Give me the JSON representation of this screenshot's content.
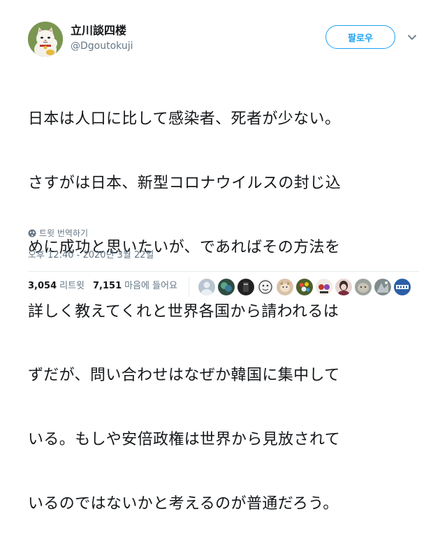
{
  "user": {
    "display_name": "立川談四楼",
    "handle": "@Dgoutokuji"
  },
  "follow_button": {
    "label": "팔로우"
  },
  "tweet": {
    "text_lines": [
      "日本は人口に比して感染者、死者が少ない。",
      "さすがは日本、新型コロナウイルスの封じ込",
      "めに成功と思いたいが、であればその方法を",
      "詳しく教えてくれと世界各国から請われるは",
      "ずだが、問い合わせはなぜか韓国に集中して",
      "いる。もしや安倍政権は世界から見放されて",
      "いるのではないかと考えるのが普通だろう。"
    ]
  },
  "translate": {
    "label": "트윗 번역하기"
  },
  "timestamp": "오후 12:40 - 2020년 3월 22일",
  "stats": {
    "retweets_count": "3,054",
    "retweets_label": "리트윗",
    "likes_count": "7,151",
    "likes_label": "마음에 들어요"
  },
  "colors": {
    "accent": "#1da1f2",
    "text_primary": "#14171a",
    "text_secondary": "#657786",
    "divider": "#e6ecf0"
  },
  "icons": {
    "globe": "globe-icon",
    "caret": "chevron-down-icon"
  }
}
